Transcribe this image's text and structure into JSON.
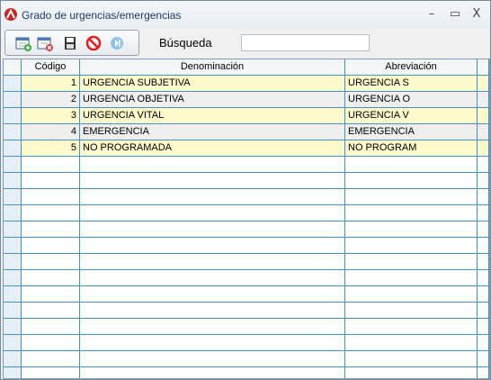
{
  "window": {
    "title": "Grado de urgencias/emergencias",
    "minimize_glyph": "–",
    "maximize_glyph": "▭",
    "close_glyph": "X"
  },
  "toolbar": {
    "items": [
      "new-record-icon",
      "delete-record-icon",
      "save-icon",
      "cancel-icon",
      "exit-icon"
    ]
  },
  "search": {
    "label": "Búsqueda",
    "value": ""
  },
  "grid": {
    "columns": [
      "Código",
      "Denominación",
      "Abreviación"
    ],
    "rows": [
      {
        "codigo": "1",
        "denominacion": "URGENCIA SUBJETIVA",
        "abreviacion": "URGENCIA S"
      },
      {
        "codigo": "2",
        "denominacion": "URGENCIA OBJETIVA",
        "abreviacion": "URGENCIA O"
      },
      {
        "codigo": "3",
        "denominacion": "URGENCIA VITAL",
        "abreviacion": "URGENCIA V"
      },
      {
        "codigo": "4",
        "denominacion": "EMERGENCIA",
        "abreviacion": "EMERGENCIA"
      },
      {
        "codigo": "5",
        "denominacion": "NO PROGRAMADA",
        "abreviacion": "NO PROGRAM"
      }
    ],
    "empty_row_count": 14
  },
  "colors": {
    "row_highlight": "#fffbcc",
    "row_alt": "#efefef",
    "grid_lines": "#4a90c8",
    "title_text": "#1e3a6e"
  }
}
